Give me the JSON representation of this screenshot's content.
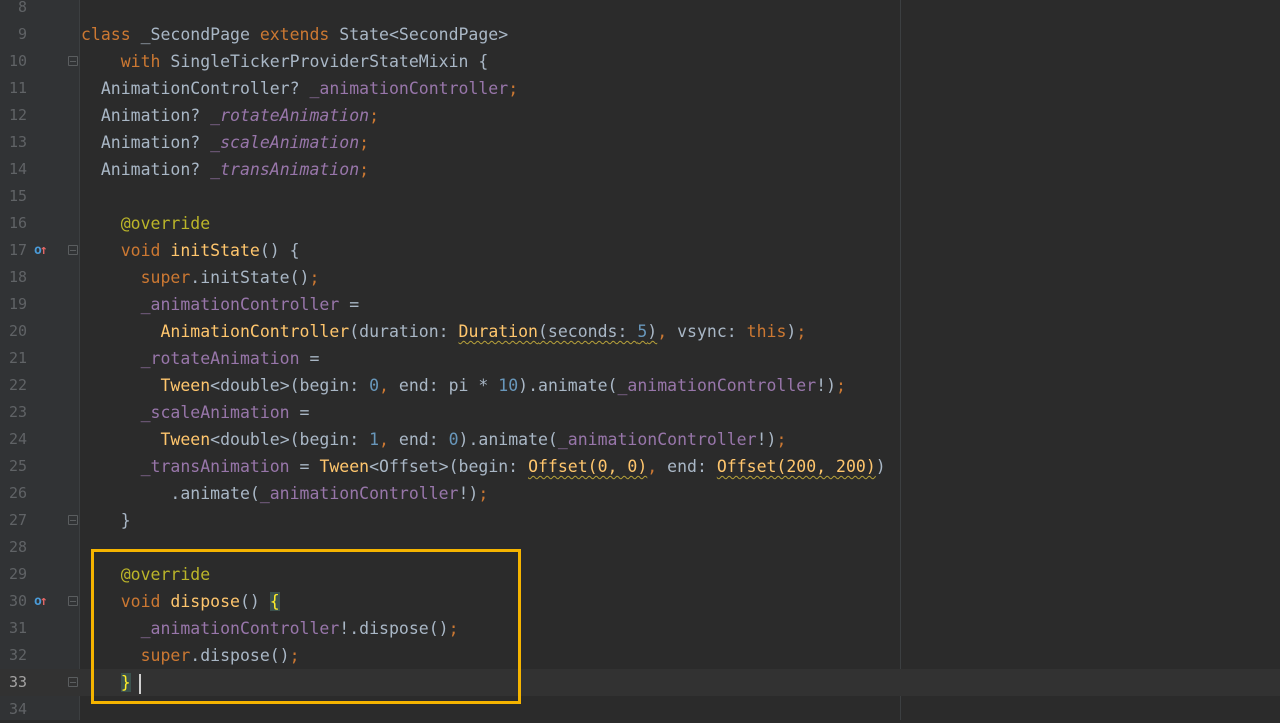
{
  "line_numbers": [
    "8",
    "9",
    "10",
    "11",
    "12",
    "13",
    "14",
    "15",
    "16",
    "17",
    "18",
    "19",
    "20",
    "21",
    "22",
    "23",
    "24",
    "25",
    "26",
    "27",
    "28",
    "29",
    "30",
    "31",
    "32",
    "33",
    "34"
  ],
  "code": {
    "l9": {
      "class_kw": "class",
      "class_name": " _SecondPage ",
      "extends_kw": "extends",
      "state_type": " State<SecondPage>"
    },
    "l10": {
      "indent": "    ",
      "with_kw": "with",
      "mixin": " SingleTickerProviderStateMixin {"
    },
    "l11": {
      "indent": "  ",
      "type": "AnimationController? ",
      "field": "_animationController",
      "semi": ";"
    },
    "l12": {
      "indent": "  ",
      "type": "Animation? ",
      "field": "_rotateAnimation",
      "semi": ";"
    },
    "l13": {
      "indent": "  ",
      "type": "Animation? ",
      "field": "_scaleAnimation",
      "semi": ";"
    },
    "l14": {
      "indent": "  ",
      "type": "Animation? ",
      "field": "_transAnimation",
      "semi": ";"
    },
    "l16": {
      "indent": "    ",
      "annotation": "@override"
    },
    "l17": {
      "indent": "    ",
      "void_kw": "void ",
      "method": "initState",
      "rest": "() {"
    },
    "l18": {
      "indent": "      ",
      "super_kw": "super",
      "rest": ".initState()",
      "semi": ";"
    },
    "l19": {
      "indent": "      ",
      "field": "_animationController",
      "rest": " ="
    },
    "l20": {
      "indent": "        ",
      "ctor": "AnimationController",
      "p1": "(duration: ",
      "dur": "Duration",
      "dur_args_open": "(seconds: ",
      "dur_num": "5",
      "dur_close": ")",
      "comma": ",",
      "p2": " vsync: ",
      "this_kw": "this",
      "p3": ")",
      "semi": ";"
    },
    "l21": {
      "indent": "      ",
      "field": "_rotateAnimation",
      "rest": " ="
    },
    "l22": {
      "indent": "        ",
      "ctor": "Tween",
      "p1": "<double>(begin: ",
      "n1": "0",
      "comma": ",",
      "p2": " end: pi * ",
      "n2": "10",
      "p3": ").animate(",
      "field": "_animationController",
      "p4": "!)",
      "semi": ";"
    },
    "l23": {
      "indent": "      ",
      "field": "_scaleAnimation",
      "rest": " ="
    },
    "l24": {
      "indent": "        ",
      "ctor": "Tween",
      "p1": "<double>(begin: ",
      "n1": "1",
      "comma": ",",
      "p2": " end: ",
      "n2": "0",
      "p3": ").animate(",
      "field": "_animationController",
      "p4": "!)",
      "semi": ";"
    },
    "l25": {
      "indent": "      ",
      "field": "_transAnimation",
      "p0": " = ",
      "ctor": "Tween",
      "p1": "<Offset>(begin: ",
      "off1": "Offset(0, 0)",
      "comma": ",",
      "p2": " end: ",
      "off2": "Offset(200, 200)",
      "p3": ")"
    },
    "l26": {
      "indent": "         ",
      "p1": ".animate(",
      "field": "_animationController",
      "p2": "!)",
      "semi": ";"
    },
    "l27": {
      "indent": "    ",
      "rest": "}"
    },
    "l29": {
      "indent": "    ",
      "annotation": "@override"
    },
    "l30": {
      "indent": "    ",
      "void_kw": "void ",
      "method": "dispose",
      "rest": "() ",
      "brace": "{"
    },
    "l31": {
      "indent": "      ",
      "field": "_animationController",
      "rest": "!.dispose()",
      "semi": ";"
    },
    "l32": {
      "indent": "      ",
      "super_kw": "super",
      "rest": ".dispose()",
      "semi": ";"
    },
    "l33": {
      "indent": "    ",
      "brace": "}"
    }
  },
  "colors": {
    "background": "#2b2b2b",
    "keyword": "#cc7832",
    "method": "#ffc66d",
    "field": "#9876aa",
    "number": "#6897bb",
    "annotation": "#bbb529",
    "highlight_box": "#f5b400"
  }
}
